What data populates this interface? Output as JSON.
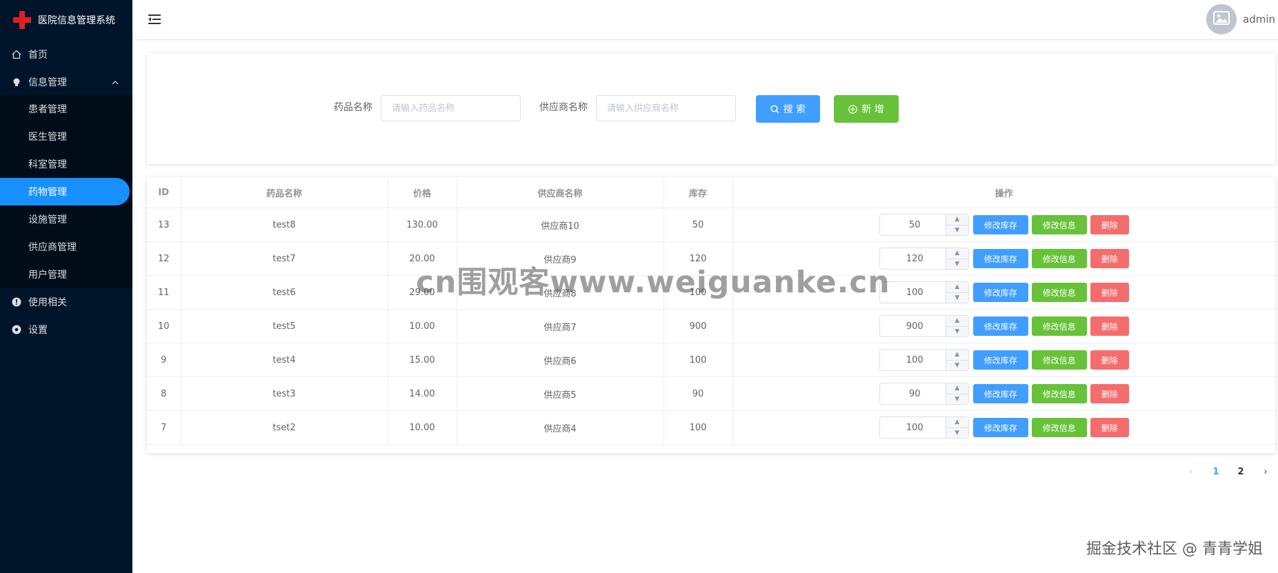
{
  "app": {
    "title": "医院信息管理系统"
  },
  "sidebar": {
    "home": "首页",
    "info_group": "信息管理",
    "sub_items": [
      "患者管理",
      "医生管理",
      "科室管理",
      "药物管理",
      "设施管理",
      "供应商管理",
      "用户管理"
    ],
    "active_index": 3,
    "usage": "使用相关",
    "settings": "设置"
  },
  "header": {
    "username": "admin"
  },
  "search": {
    "drug_label": "药品名称",
    "drug_placeholder": "请输入药品名称",
    "drug_value": "",
    "supplier_label": "供应商名称",
    "supplier_placeholder": "请输入供应商名称",
    "supplier_value": "",
    "search_button": "搜 索",
    "add_button": "新 增"
  },
  "table": {
    "columns": [
      "ID",
      "药品名称",
      "价格",
      "供应商名称",
      "库存",
      "操作"
    ],
    "rows": [
      {
        "id": "13",
        "name": "test8",
        "price": "130.00",
        "supplier": "供应商10",
        "stock": "50",
        "input": "50"
      },
      {
        "id": "12",
        "name": "test7",
        "price": "20.00",
        "supplier": "供应商9",
        "stock": "120",
        "input": "120"
      },
      {
        "id": "11",
        "name": "test6",
        "price": "29.00",
        "supplier": "供应商8",
        "stock": "100",
        "input": "100"
      },
      {
        "id": "10",
        "name": "test5",
        "price": "10.00",
        "supplier": "供应商7",
        "stock": "900",
        "input": "900"
      },
      {
        "id": "9",
        "name": "test4",
        "price": "15.00",
        "supplier": "供应商6",
        "stock": "100",
        "input": "100"
      },
      {
        "id": "8",
        "name": "test3",
        "price": "14.00",
        "supplier": "供应商5",
        "stock": "90",
        "input": "90"
      },
      {
        "id": "7",
        "name": "tset2",
        "price": "10.00",
        "supplier": "供应商4",
        "stock": "100",
        "input": "100"
      }
    ],
    "actions": {
      "edit_stock": "修改库存",
      "edit_info": "修改信息",
      "delete": "删除"
    }
  },
  "pagination": {
    "pages": [
      "1",
      "2"
    ],
    "current": "1"
  },
  "watermarks": {
    "center": "cn围观客www.weiguanke.cn",
    "footer": "掘金技术社区 @ 青青学姐"
  },
  "colors": {
    "sidebar_bg": "#001529",
    "active": "#1890ff",
    "primary": "#409eff",
    "success": "#67c23a",
    "danger": "#f56c6c"
  },
  "icons": [
    "home-icon",
    "bulb-icon",
    "chevron-up-icon",
    "info-icon",
    "settings-icon",
    "menu-fold-icon",
    "avatar-image-icon",
    "search-icon",
    "plus-circle-icon",
    "chevron-left-icon",
    "chevron-right-icon"
  ]
}
